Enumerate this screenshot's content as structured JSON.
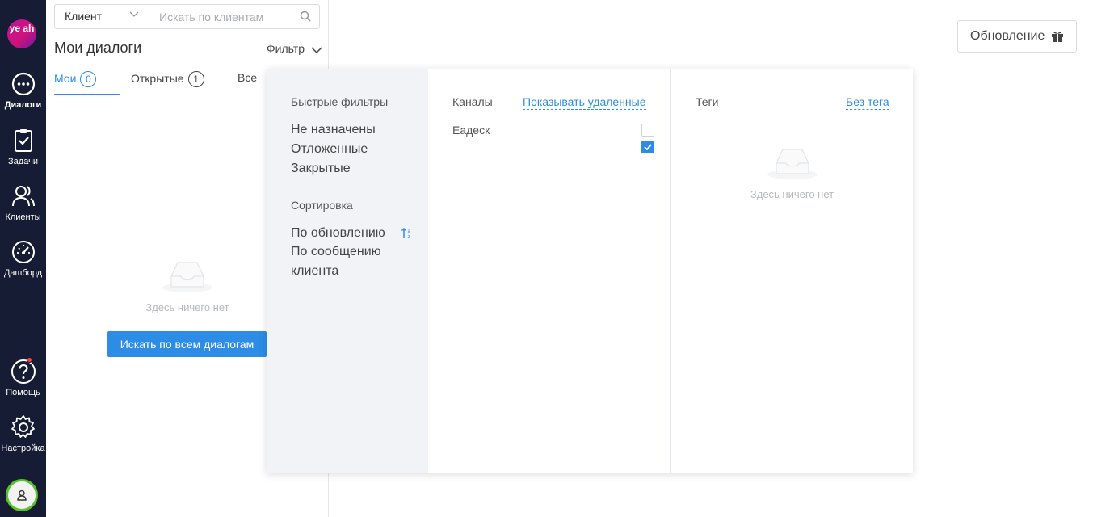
{
  "sidebar": {
    "logo_text": "ye ah",
    "items": [
      {
        "label": "Диалоги",
        "icon": "chat-bubble-icon"
      },
      {
        "label": "Задачи",
        "icon": "clipboard-check-icon"
      },
      {
        "label": "Клиенты",
        "icon": "users-icon"
      },
      {
        "label": "Дашборд",
        "icon": "gauge-icon"
      },
      {
        "label": "Помощь",
        "icon": "help-icon"
      },
      {
        "label": "Настройка",
        "icon": "gear-icon"
      }
    ],
    "help_has_notification": true,
    "colors": {
      "background": "#151c33",
      "online_ring": "#58c12b",
      "logo": "#d1127a"
    }
  },
  "list": {
    "search_type": "Клиент",
    "search_placeholder": "Искать по клиентам",
    "title": "Мои диалоги",
    "filter_label": "Фильтр",
    "tabs": [
      {
        "label": "Мои",
        "count": "0",
        "active": true
      },
      {
        "label": "Открытые",
        "count": "1",
        "active": false
      },
      {
        "label": "Все",
        "count": "",
        "active": false
      }
    ],
    "empty_text": "Здесь ничего нет",
    "search_all_button": "Искать по всем диалогам"
  },
  "header": {
    "update_button": "Обновление"
  },
  "filter_popup": {
    "quick_filters_title": "Быстрые фильтры",
    "quick_filters": [
      "Не назначены",
      "Отложенные",
      "Закрытые"
    ],
    "sort_title": "Сортировка",
    "sort_options": [
      "По обновлению",
      "По сообщению клиента"
    ],
    "channels_title": "Каналы",
    "show_deleted_link": "Показывать удаленные",
    "channels": [
      {
        "name": "Еадеск",
        "checked": false
      }
    ],
    "extra_checkbox_checked": true,
    "tags_title": "Теги",
    "no_tag_link": "Без тега",
    "tags_empty_text": "Здесь ничего нет"
  },
  "accent_color": "#2d8ce6"
}
